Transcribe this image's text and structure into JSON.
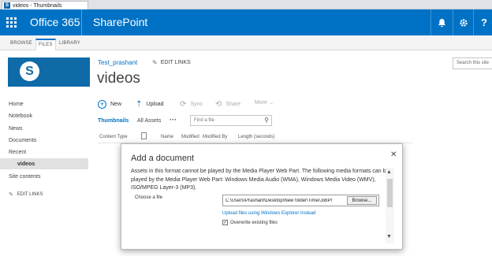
{
  "browser": {
    "tab_title": "videos - Thumbnails",
    "favicon": "S"
  },
  "suitebar": {
    "app_launcher_icon": "waffle-icon",
    "product": "Office 365",
    "app": "SharePoint",
    "icons": [
      "bell-icon",
      "gear-icon",
      "help-icon"
    ],
    "help_glyph": "?",
    "color": "#0072c6"
  },
  "ribbon": {
    "tabs": [
      "BROWSE",
      "FILES",
      "LIBRARY"
    ],
    "active": "FILES"
  },
  "site": {
    "logo_letter": "S",
    "site_name": "Test_prashant",
    "edit_links": "EDIT LINKS",
    "title": "videos",
    "search_placeholder": "Search this site"
  },
  "leftnav": {
    "items": [
      "Home",
      "Notebook",
      "News",
      "Documents",
      "Recent"
    ],
    "sub_item": "videos",
    "site_contents": "Site contents",
    "edit_links": "EDIT LINKS"
  },
  "commands": {
    "new": "New",
    "upload": "Upload",
    "sync": "Sync",
    "share": "Share",
    "more": "More"
  },
  "views": {
    "thumbnails": "Thumbnails",
    "all_assets": "All Assets",
    "more": "···",
    "find_placeholder": "Find a file"
  },
  "columns": [
    "Content Type",
    "Name",
    "Modified",
    "Modified By",
    "Length (seconds)"
  ],
  "dialog": {
    "title": "Add a document",
    "close": "✕",
    "message": "Assets in this format cannot be played by the Media Player Web Part. The following media formats can be played by the Media Player Web Part: Windows Media Audio (WMA), Windows Media Video (WMV), ISO/MPEG Layer-3 (MP3).",
    "choose_label": "Choose a file",
    "file_path": "C:\\Users\\Prashant\\Desktop\\New folder\\TimerJobPr",
    "browse": "Browse...",
    "explorer_link": "Upload files using Windows Explorer instead",
    "overwrite_label": "Overwrite existing files",
    "overwrite_checked": true
  }
}
